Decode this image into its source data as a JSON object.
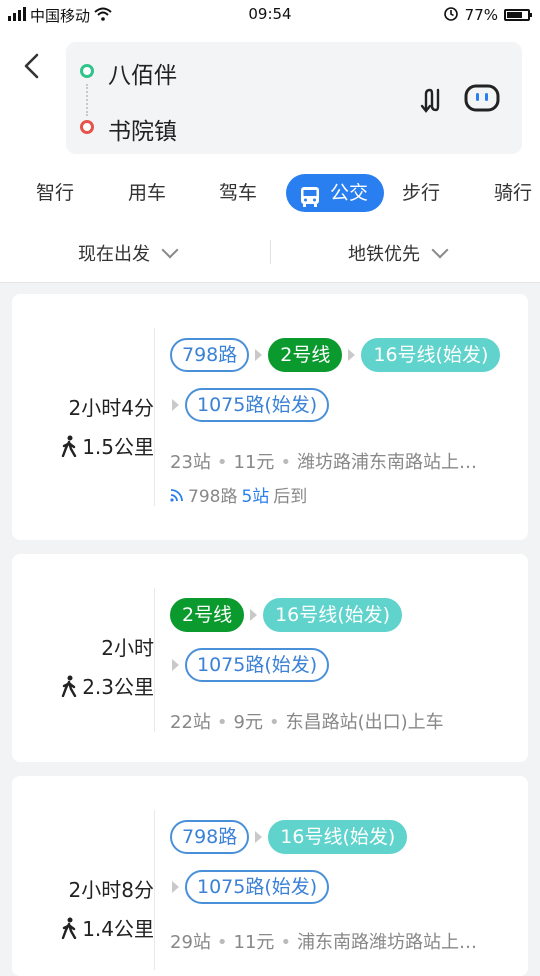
{
  "status": {
    "carrier": "中国移动",
    "time": "09:54",
    "battery": "77%",
    "battery_level": 0.77
  },
  "route": {
    "from": "八佰伴",
    "to": "书院镇"
  },
  "tabs": [
    {
      "label": "智行"
    },
    {
      "label": "用车"
    },
    {
      "label": "驾车"
    },
    {
      "label": "公交",
      "active": true
    },
    {
      "label": "步行"
    },
    {
      "label": "骑行"
    }
  ],
  "filters": {
    "depart": "现在出发",
    "pref": "地铁优先"
  },
  "results": [
    {
      "duration": "2小时4分",
      "walk": "1.5公里",
      "row1": [
        "798路",
        "2号线",
        "16号线(始发)"
      ],
      "row2": [
        "1075路(始发)"
      ],
      "stops": "23站",
      "price": "11元",
      "board": "潍坊路浦东南路站上…",
      "realtime_prefix": "798路",
      "realtime_count": "5站",
      "realtime_suffix": "后到"
    },
    {
      "duration": "2小时",
      "walk": "2.3公里",
      "row1": [
        "2号线",
        "16号线(始发)"
      ],
      "row2": [
        "1075路(始发)"
      ],
      "stops": "22站",
      "price": "9元",
      "board": "东昌路站(出口)上车"
    },
    {
      "duration": "2小时8分",
      "walk": "1.4公里",
      "row1": [
        "798路",
        "16号线(始发)"
      ],
      "row2": [
        "1075路(始发)"
      ],
      "stops": "29站",
      "price": "11元",
      "board": "浦东南路潍坊路站上…"
    }
  ]
}
